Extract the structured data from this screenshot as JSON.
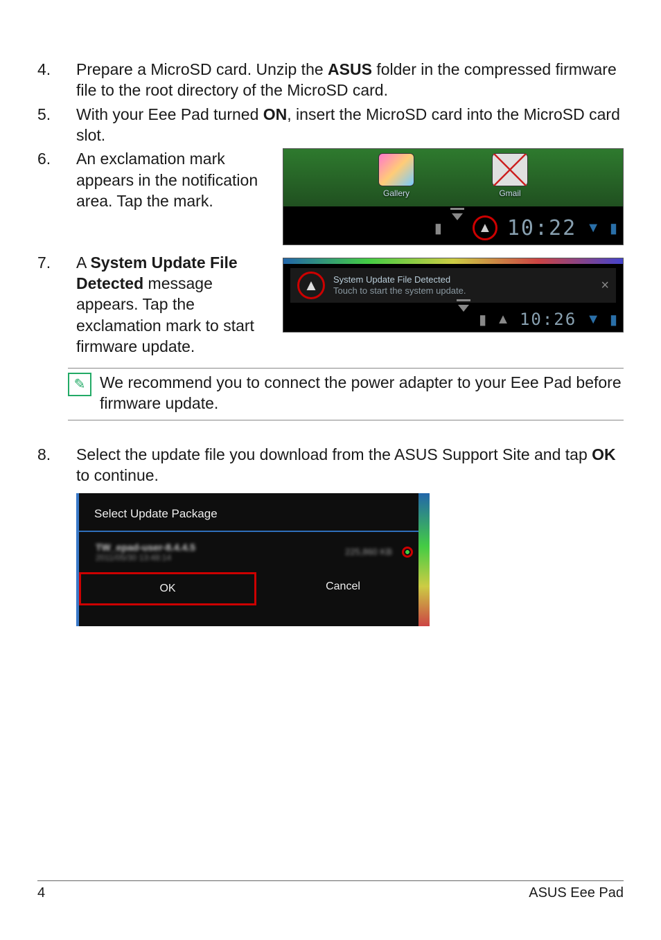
{
  "steps": {
    "s4": {
      "num": "4.",
      "pre": "Prepare a MicroSD card. Unzip the ",
      "bold": "ASUS",
      "post": " folder in the compressed firmware file to the root directory of the MicroSD card."
    },
    "s5": {
      "num": "5.",
      "pre": "With your Eee Pad turned ",
      "bold": "ON",
      "post": ", insert the MicroSD card into the MicroSD card slot."
    },
    "s6": {
      "num": "6.",
      "text": "An exclamation mark appears in the notification area. Tap the mark."
    },
    "s7": {
      "num": "7.",
      "pre": "A ",
      "bold": "System Update File Detected",
      "post": " message appears. Tap the exclamation mark to start firmware update."
    },
    "s8": {
      "num": "8.",
      "pre": "Select the update file you download from the ASUS Support Site and tap ",
      "bold": "OK",
      "post": " to continue."
    }
  },
  "note": "We recommend you to connect the power adapter to your Eee Pad before firmware update.",
  "screenshot1": {
    "app1": "Gallery",
    "app2": "Gmail",
    "alert_glyph": "▲",
    "time": "10:22"
  },
  "screenshot2": {
    "alert_glyph": "▲",
    "title": "System Update File Detected",
    "subtitle": "Touch to start the system update.",
    "close_glyph": "×",
    "time": "10:26"
  },
  "screenshot3": {
    "title": "Select Update Package",
    "pkg_name": "TW_epad-user-8.4.4.5",
    "pkg_date": "2011/05/30 13:48:14",
    "pkg_size": "225,860 KB",
    "ok": "OK",
    "cancel": "Cancel"
  },
  "footer": {
    "page": "4",
    "product": "ASUS Eee Pad"
  }
}
